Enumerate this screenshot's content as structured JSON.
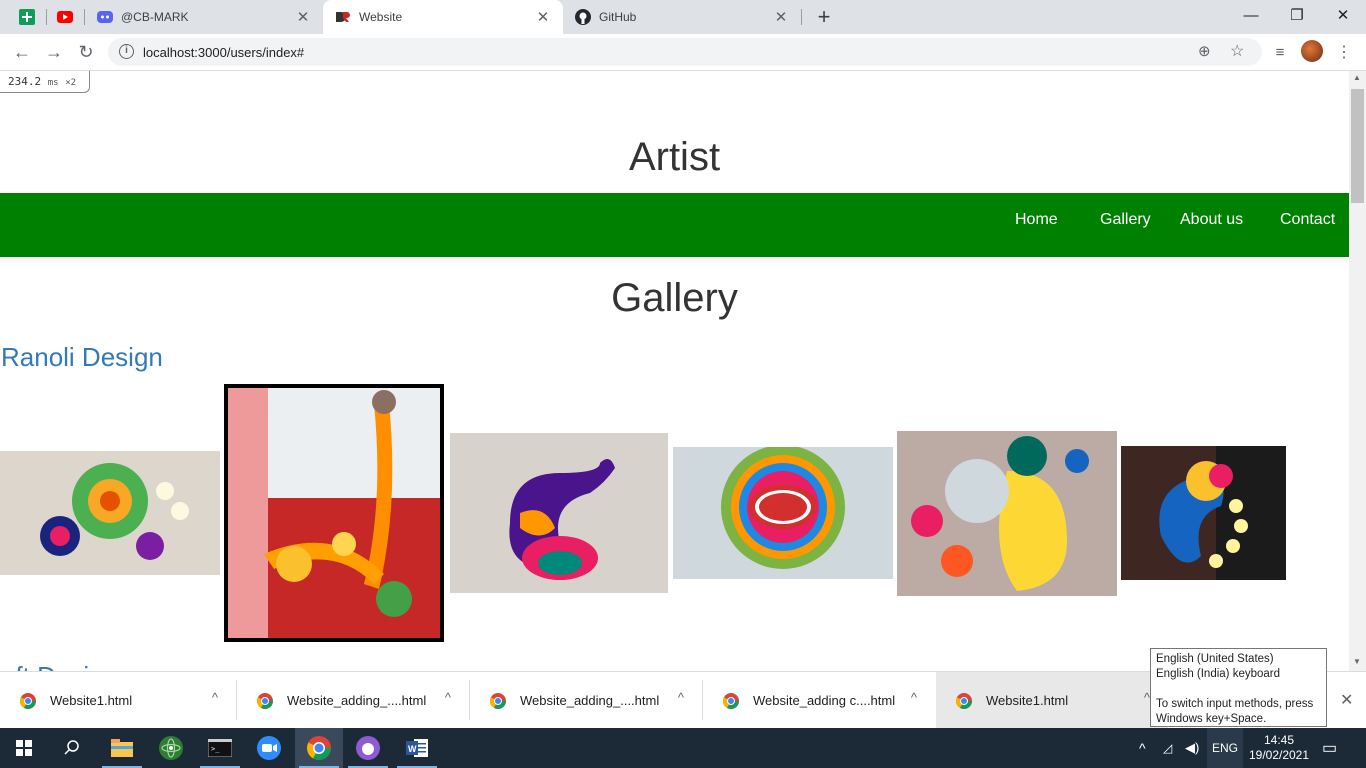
{
  "browser": {
    "tabs": [
      {
        "title": "@CB-MARK"
      },
      {
        "title": "Website"
      },
      {
        "title": "GitHub"
      }
    ],
    "address_url": "localhost:3000/users/index#"
  },
  "page": {
    "timing_value": "234.2",
    "timing_unit": "ms",
    "timing_mult": "×2",
    "site_title": "Artist",
    "nav": [
      "Home",
      "Gallery",
      "About us",
      "Contact"
    ],
    "gallery_title": "Gallery",
    "section_title": "Ranoli Design",
    "next_section_partial": "aft Desi"
  },
  "downloads": [
    {
      "name": "Website1.html"
    },
    {
      "name": "Website_adding_....html"
    },
    {
      "name": "Website_adding_....html"
    },
    {
      "name": "Website_adding c....html"
    },
    {
      "name": "Website1.html"
    }
  ],
  "tooltip": {
    "line1": "English (United States)",
    "line2": "English (India) keyboard",
    "line3": "To switch input methods, press",
    "line4": "Windows key+Space."
  },
  "taskbar": {
    "lang": "ENG",
    "time": "14:45",
    "date": "19/02/2021"
  }
}
